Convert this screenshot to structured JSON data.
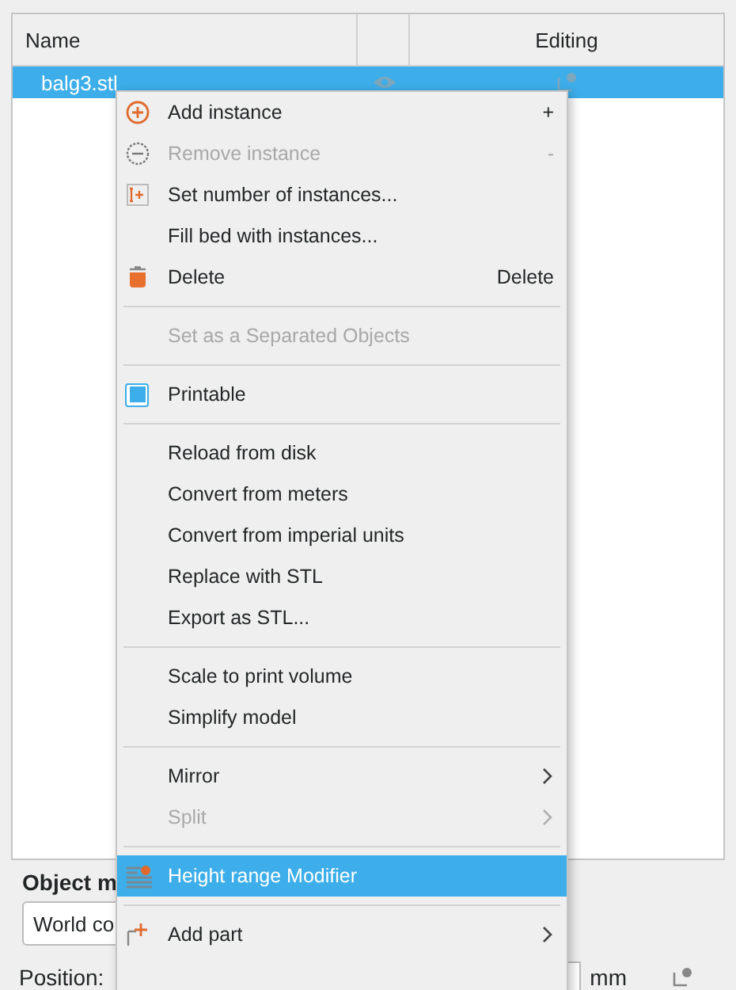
{
  "table": {
    "columns": [
      {
        "label": "Name"
      },
      {},
      {
        "label": "Editing"
      }
    ],
    "rows": [
      {
        "name": "balg3.stl",
        "selected": true
      }
    ]
  },
  "object_manipulation": {
    "title": "Object m",
    "coordinates": "World co",
    "position_label": "Position:",
    "unit": "mm"
  },
  "context_menu": {
    "items": [
      {
        "kind": "item",
        "label": "Add instance",
        "shortcut": "+",
        "disabled": false,
        "selected": false
      },
      {
        "kind": "item",
        "label": "Remove instance",
        "shortcut": "-",
        "disabled": true,
        "selected": false
      },
      {
        "kind": "item",
        "label": "Set number of instances...",
        "disabled": false,
        "selected": false
      },
      {
        "kind": "item",
        "label": "Fill bed with instances...",
        "disabled": false,
        "selected": false
      },
      {
        "kind": "item",
        "label": "Delete",
        "shortcut": "Delete",
        "disabled": false,
        "selected": false
      },
      {
        "kind": "separator"
      },
      {
        "kind": "item",
        "label": "Set as a Separated Objects",
        "disabled": true,
        "selected": false
      },
      {
        "kind": "separator"
      },
      {
        "kind": "checkbox",
        "label": "Printable",
        "checked": true,
        "disabled": false,
        "selected": false
      },
      {
        "kind": "separator"
      },
      {
        "kind": "item",
        "label": "Reload from disk",
        "disabled": false,
        "selected": false
      },
      {
        "kind": "item",
        "label": "Convert from meters",
        "disabled": false,
        "selected": false
      },
      {
        "kind": "item",
        "label": "Convert from imperial units",
        "disabled": false,
        "selected": false
      },
      {
        "kind": "item",
        "label": "Replace with STL",
        "disabled": false,
        "selected": false
      },
      {
        "kind": "item",
        "label": "Export as STL...",
        "disabled": false,
        "selected": false
      },
      {
        "kind": "separator"
      },
      {
        "kind": "item",
        "label": "Scale to print volume",
        "disabled": false,
        "selected": false
      },
      {
        "kind": "item",
        "label": "Simplify model",
        "disabled": false,
        "selected": false
      },
      {
        "kind": "separator"
      },
      {
        "kind": "submenu",
        "label": "Mirror",
        "disabled": false,
        "selected": false
      },
      {
        "kind": "submenu",
        "label": "Split",
        "disabled": true,
        "selected": false
      },
      {
        "kind": "separator"
      },
      {
        "kind": "item",
        "label": "Height range Modifier",
        "disabled": false,
        "selected": true
      },
      {
        "kind": "separator"
      },
      {
        "kind": "submenu",
        "label": "Add part",
        "disabled": false,
        "selected": false
      }
    ]
  }
}
